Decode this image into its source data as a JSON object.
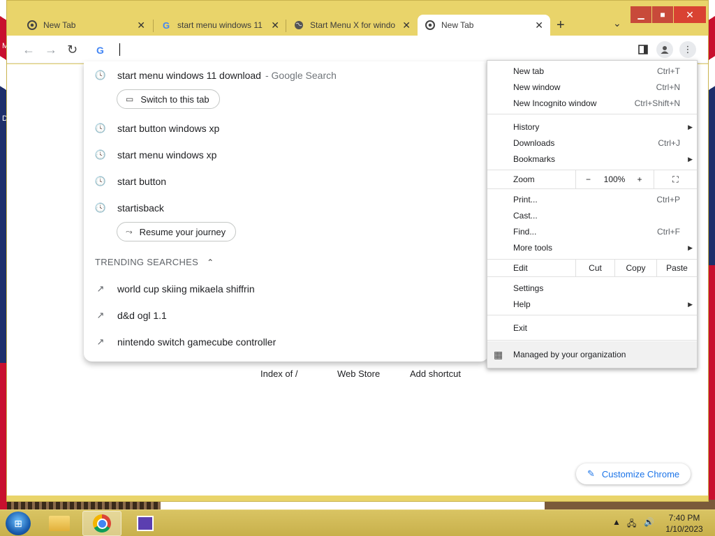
{
  "desktop": {
    "edge_letters": [
      "M",
      "D"
    ]
  },
  "tabs": [
    {
      "title": "New Tab",
      "icon": "chrome-icon"
    },
    {
      "title": "start menu windows 11",
      "icon": "google-icon"
    },
    {
      "title": "Start Menu X for windo",
      "icon": "globe-icon"
    },
    {
      "title": "New Tab",
      "icon": "chrome-icon",
      "active": true
    }
  ],
  "window_controls": {
    "minimize": "▁",
    "maximize": "■",
    "close": "✕"
  },
  "omnibox": {
    "value": ""
  },
  "suggestions": {
    "items": [
      {
        "text": "start menu windows 11 download",
        "suffix": "- Google Search"
      },
      {
        "text": "start button windows xp"
      },
      {
        "text": "start menu windows xp"
      },
      {
        "text": "start button"
      },
      {
        "text": "startisback"
      }
    ],
    "chips": {
      "switch_tab": "Switch to this tab",
      "resume": "Resume your journey"
    },
    "trending_header": "TRENDING SEARCHES",
    "trending": [
      "world cup skiing mikaela shiffrin",
      "d&d ogl 1.1",
      "nintendo switch gamecube controller"
    ]
  },
  "newtab_page": {
    "shortcuts": [
      "Index of /",
      "Web Store",
      "Add shortcut"
    ],
    "customize_label": "Customize Chrome"
  },
  "app_menu": {
    "new_tab": {
      "label": "New tab",
      "shortcut": "Ctrl+T"
    },
    "new_window": {
      "label": "New window",
      "shortcut": "Ctrl+N"
    },
    "new_incognito": {
      "label": "New Incognito window",
      "shortcut": "Ctrl+Shift+N"
    },
    "history": {
      "label": "History"
    },
    "downloads": {
      "label": "Downloads",
      "shortcut": "Ctrl+J"
    },
    "bookmarks": {
      "label": "Bookmarks"
    },
    "zoom": {
      "label": "Zoom",
      "minus": "−",
      "value": "100%",
      "plus": "+"
    },
    "print": {
      "label": "Print...",
      "shortcut": "Ctrl+P"
    },
    "cast": {
      "label": "Cast..."
    },
    "find": {
      "label": "Find...",
      "shortcut": "Ctrl+F"
    },
    "more_tools": {
      "label": "More tools"
    },
    "edit": {
      "label": "Edit",
      "cut": "Cut",
      "copy": "Copy",
      "paste": "Paste"
    },
    "settings": {
      "label": "Settings"
    },
    "help": {
      "label": "Help"
    },
    "exit": {
      "label": "Exit"
    },
    "managed": {
      "label": "Managed by your organization"
    }
  },
  "taskbar": {
    "clock_time": "7:40 PM",
    "clock_date": "1/10/2023"
  }
}
